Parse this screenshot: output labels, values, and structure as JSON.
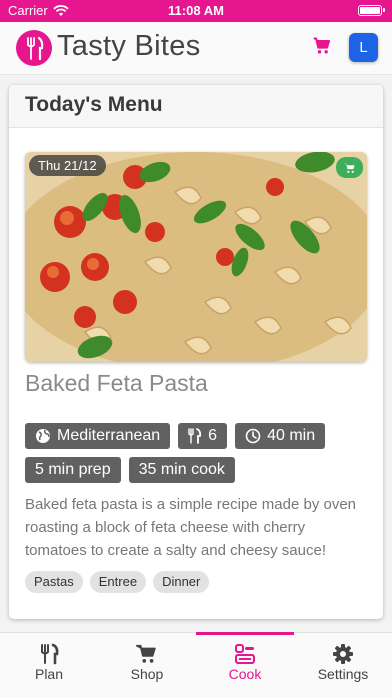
{
  "status": {
    "carrier": "Carrier",
    "time": "11:08 AM"
  },
  "app": {
    "title": "Tasty Bites",
    "avatar_letter": "L"
  },
  "card": {
    "title": "Today's Menu",
    "date": "Thu 21/12",
    "recipe_name": "Baked Feta Pasta",
    "tags": {
      "cuisine": "Mediterranean",
      "servings": "6",
      "total_time": "40 min",
      "prep": "5 min prep",
      "cook": "35 min cook"
    },
    "description": "Baked feta pasta is a simple recipe made by oven roasting a block of feta cheese with cherry tomatoes to create a salty and cheesy sauce!",
    "categories": [
      "Pastas",
      "Entree",
      "Dinner"
    ]
  },
  "tabs": [
    {
      "label": "Plan",
      "icon": "fork-knife-icon"
    },
    {
      "label": "Shop",
      "icon": "cart-icon"
    },
    {
      "label": "Cook",
      "icon": "cook-icon",
      "active": true
    },
    {
      "label": "Settings",
      "icon": "gear-icon"
    }
  ],
  "colors": {
    "brand": "#e6168f",
    "avatar": "#1c63e6",
    "tag": "#616161",
    "cart_badge": "#3fae5a"
  }
}
